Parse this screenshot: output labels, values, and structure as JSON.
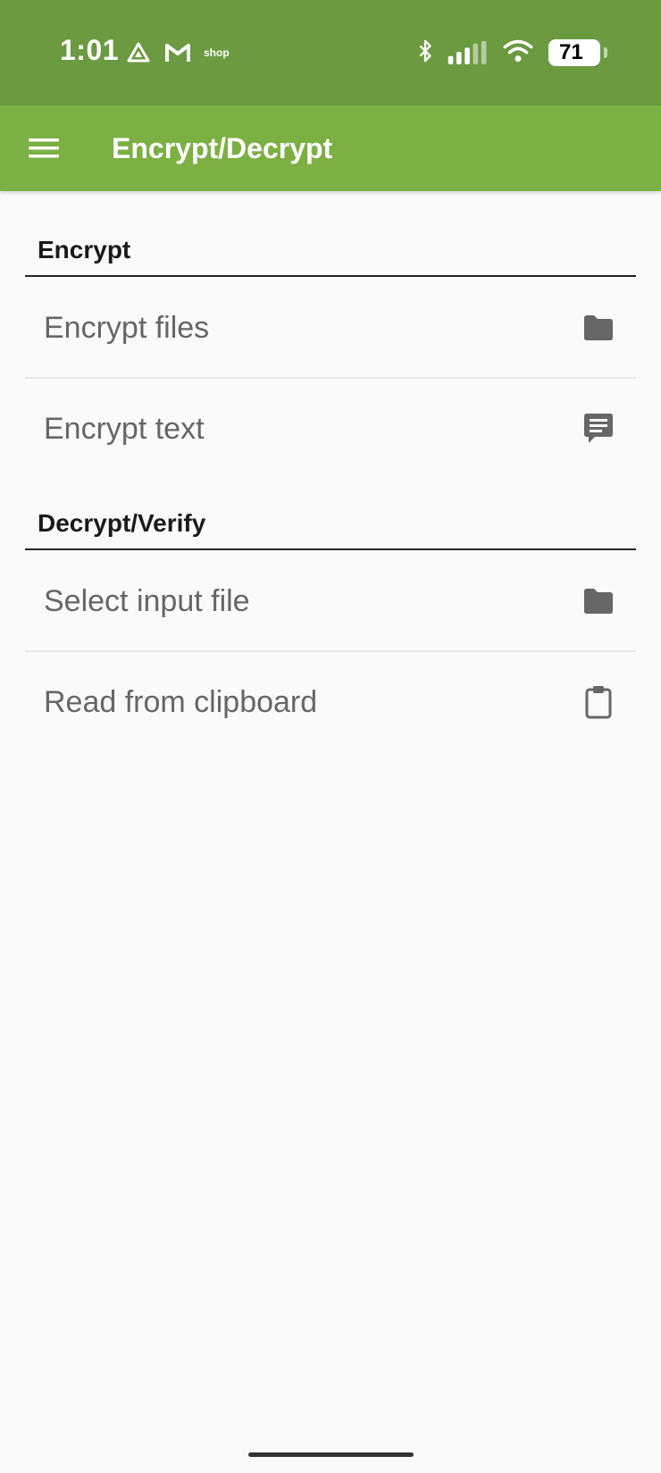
{
  "status_bar": {
    "time": "1:01",
    "notification_text": "shop",
    "battery": "71"
  },
  "app_bar": {
    "title": "Encrypt/Decrypt"
  },
  "sections": [
    {
      "header": "Encrypt",
      "items": [
        {
          "label": "Encrypt files",
          "icon": "folder-icon"
        },
        {
          "label": "Encrypt text",
          "icon": "message-icon"
        }
      ]
    },
    {
      "header": "Decrypt/Verify",
      "items": [
        {
          "label": "Select input file",
          "icon": "folder-icon"
        },
        {
          "label": "Read from clipboard",
          "icon": "clipboard-icon"
        }
      ]
    }
  ],
  "colors": {
    "status_bar": "#6b9a40",
    "app_bar": "#7cb043",
    "background": "#fafafa"
  }
}
